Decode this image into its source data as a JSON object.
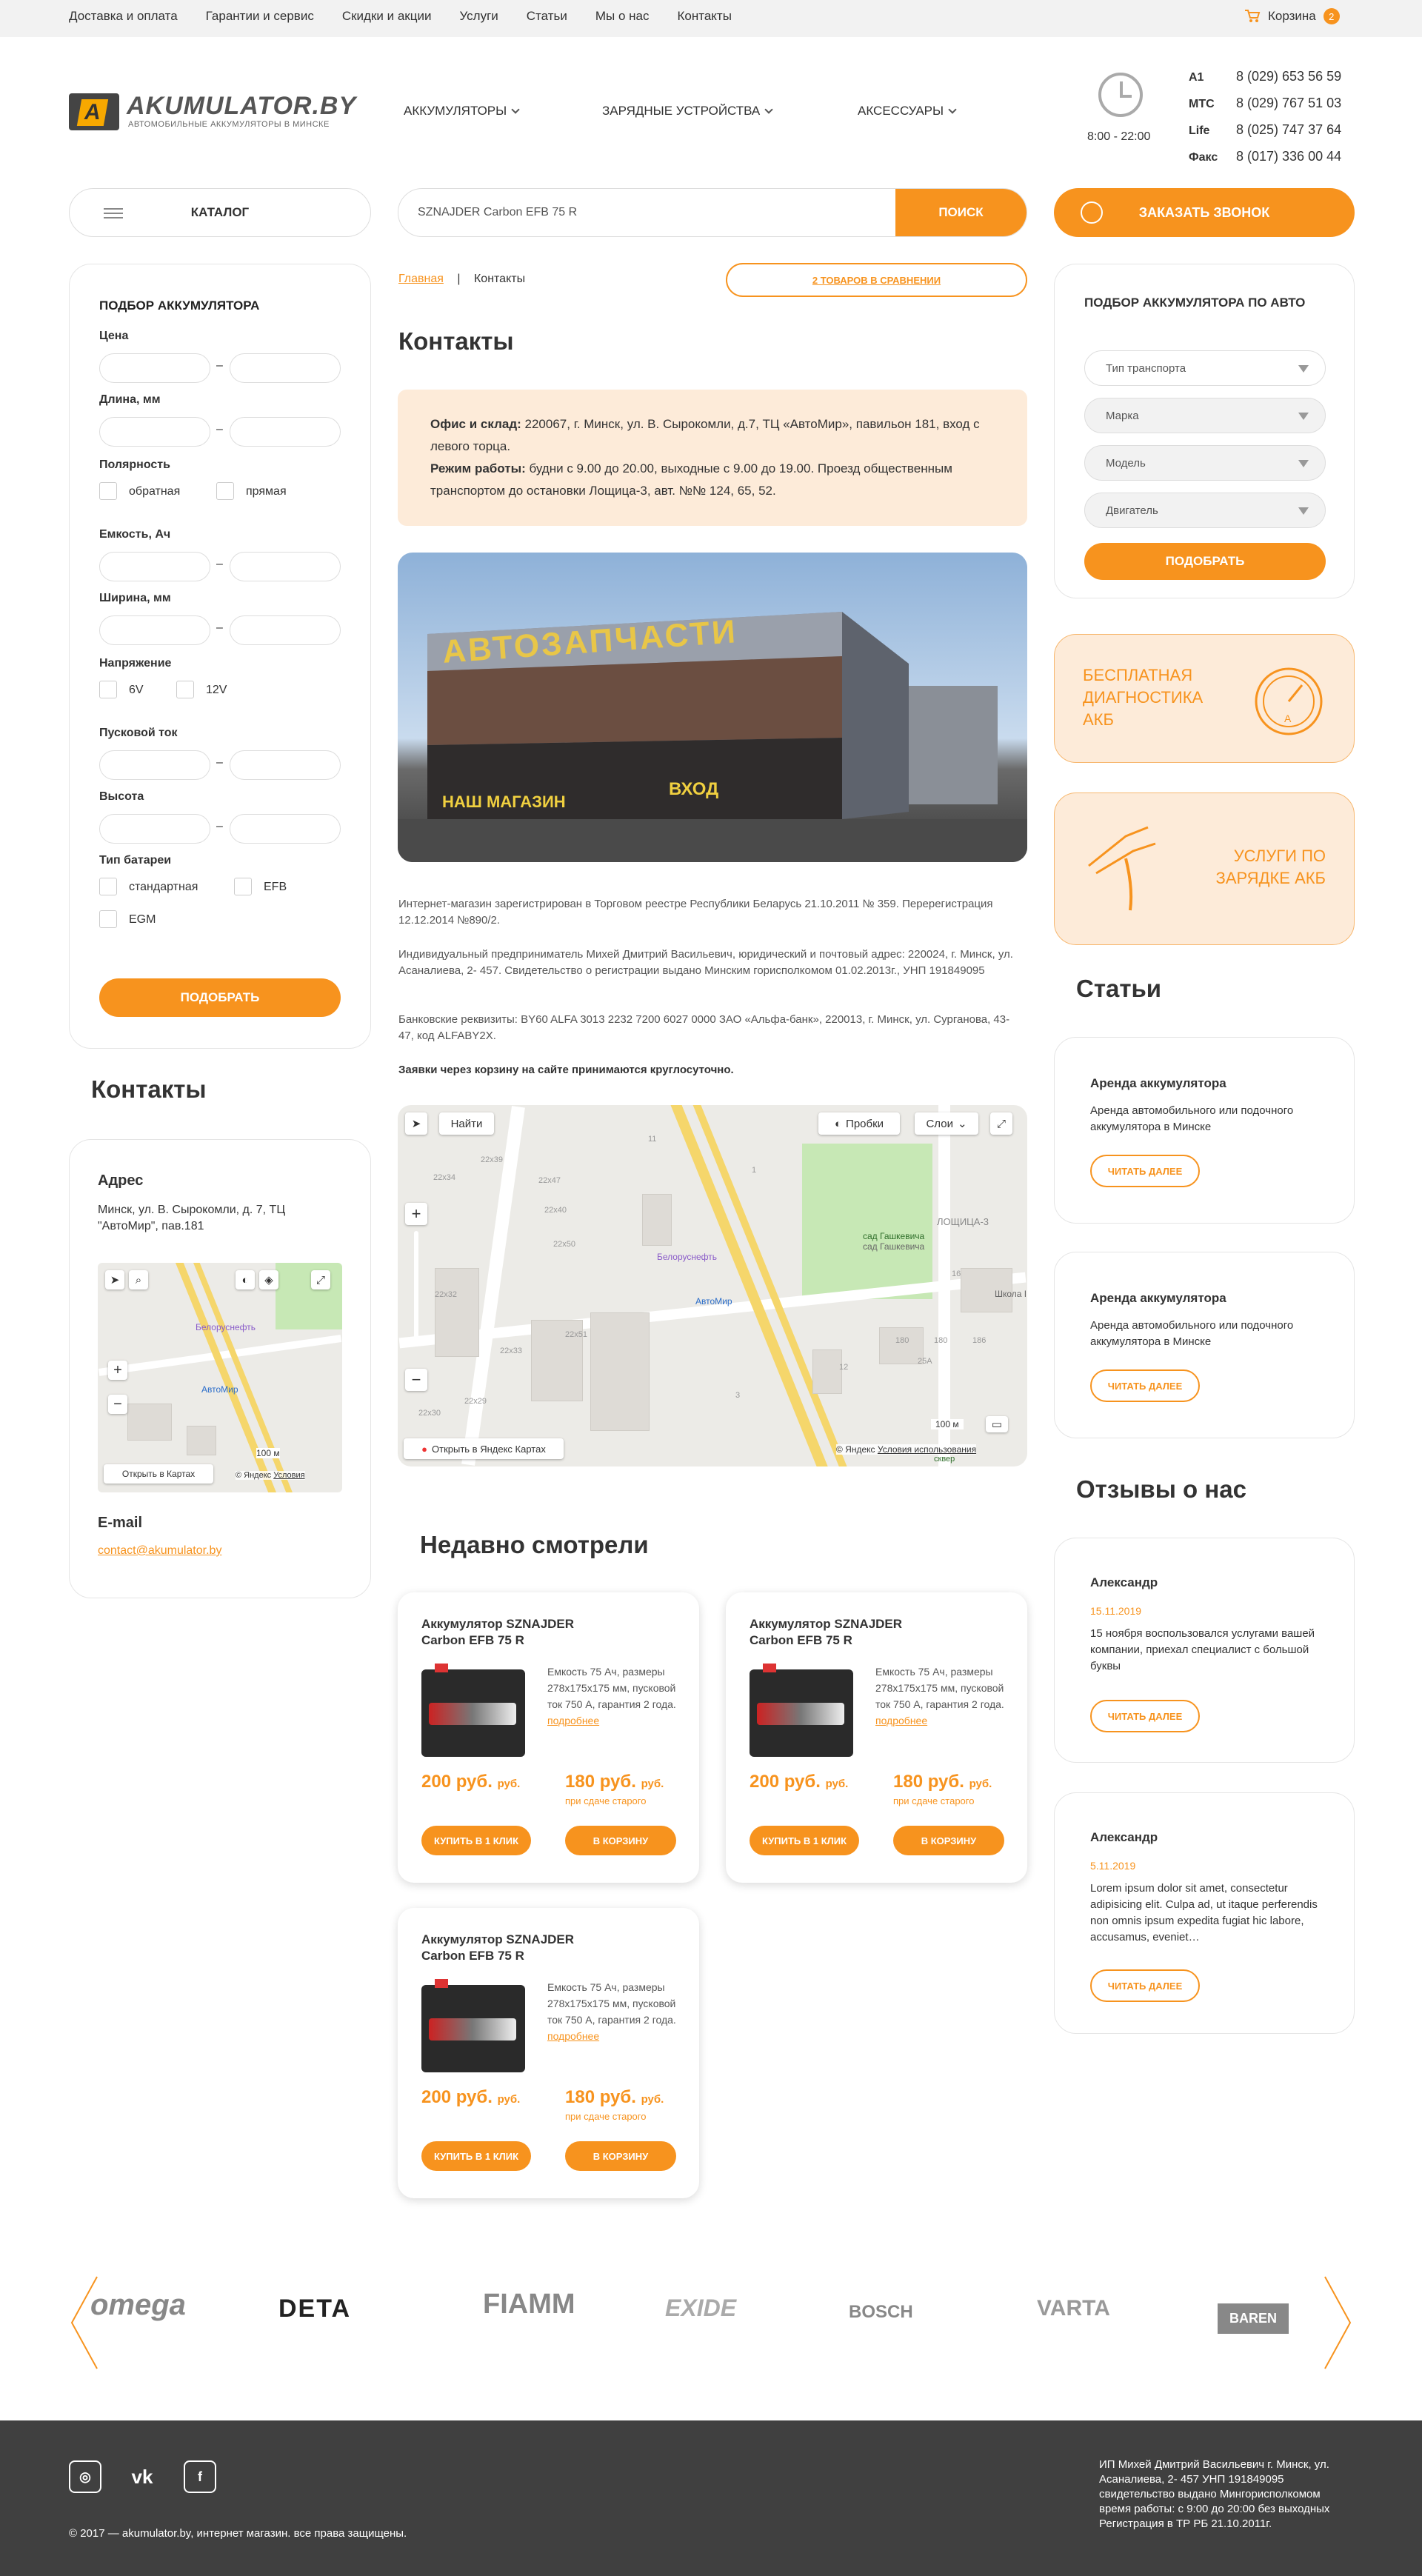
{
  "topnav": [
    "Доставка и оплата",
    "Гарантии и сервис",
    "Скидки и акции",
    "Услуги",
    "Статьи",
    "Мы о нас",
    "Контакты"
  ],
  "cart": {
    "label": "Корзина",
    "count": "2"
  },
  "logo": {
    "brand": "AKUMULATOR.BY",
    "tagline": "АВТОМОБИЛЬНЫЕ АККУМУЛЯТОРЫ В МИНСКЕ"
  },
  "mainnav": [
    "АККУМУЛЯТОРЫ",
    "ЗАРЯДНЫЕ УСТРОЙСТВА",
    "АКСЕССУАРЫ"
  ],
  "hours": "8:00 - 22:00",
  "phones": [
    {
      "op": "A1",
      "num": "8 (029) 653 56 59"
    },
    {
      "op": "МТС",
      "num": "8 (029) 767 51 03"
    },
    {
      "op": "Life",
      "num": "8 (025) 747 37 64"
    },
    {
      "op": "Факс",
      "num": "8 (017) 336 00 44"
    }
  ],
  "catalog_label": "КАТАЛОГ",
  "search": {
    "value": "SZNAJDER Carbon EFB 75 R",
    "button": "ПОИСК"
  },
  "call_label": "ЗАКАЗАТЬ ЗВОНОК",
  "filter": {
    "title": "ПОДБОР АККУМУЛЯТОРА",
    "price": "Цена",
    "length": "Длина, мм",
    "polarity": "Полярность",
    "polarity_opts": [
      "обратная",
      "прямая"
    ],
    "capacity": "Емкость, Ач",
    "width": "Ширина, мм",
    "voltage": "Напряжение",
    "voltage_opts": [
      "6V",
      "12V"
    ],
    "start": "Пусковой ток",
    "height": "Высота",
    "type": "Тип батареи",
    "type_opts": [
      "стандартная",
      "EFB",
      "EGM"
    ],
    "dash": "–",
    "button": "ПОДОБРАТЬ"
  },
  "contacts_side": {
    "title": "Контакты",
    "addr_title": "Адрес",
    "addr": "Минск, ул. В. Сырокомли, д. 7, ТЦ \"АвтоМир\", пав.181",
    "email_title": "E-mail",
    "email": "contact@akumulator.by"
  },
  "small_map": {
    "poi1": "Белоруснефть",
    "poi2": "АвтоМир",
    "scale": "100 м",
    "open": "Открыть в Картах",
    "credit": "© Яндекс",
    "terms": "Условия"
  },
  "breadcrumbs": {
    "home": "Главная",
    "sep": "|",
    "current": "Контакты"
  },
  "compare": "2 ТОВАРОВ В СРАВНЕНИИ",
  "page_title": "Контакты",
  "office": {
    "l1": "Офис и склад:",
    "t1": "220067, г. Минск, ул. В. Сырокомли, д.7, ТЦ «АвтоМир», павильон 181, вход с левого торца.",
    "l2": "Режим работы:",
    "t2": "будни с 9.00 до 20.00, выходные с 9.00 до 19.00. Проезд общественным транспортом до остановки Лощица-3, авт. №№ 124, 65, 52."
  },
  "photo": {
    "sign": "АВТОЗАПЧАСТИ",
    "store": "НАШ МАГАЗИН",
    "entrance": "ВХОД"
  },
  "texts": [
    "Интернет-магазин зарегистрирован в Торговом реестре Республики Беларусь 21.10.2011 № 359. Перерегистрация 12.12.2014 №890/2.",
    "Индивидуальный предприниматель Михей Дмитрий Васильевич, юридический и почтовый адрес: 220024, г. Минск, ул. Асаналиева, 2- 457. Свидетельство о регистрации выдано Минским горисполкомом 01.02.2013г., УНП 191849095",
    "Банковские реквизиты: BY60 ALFA 3013 2232 7200 6027 0000 ЗАО «Альфа-банк», 220013, г. Минск, ул. Сурганова, 43-47, код ALFABY2X.",
    "Заявки через корзину на сайте принимаются круглосуточно."
  ],
  "big_map": {
    "find": "Найти",
    "traffic": "Пробки",
    "layers": "Слои",
    "park": "сад Гашкевича",
    "park2": "сад Гашкевича",
    "area": "ЛОЩИЦА-3",
    "poi1": "Белоруснефть",
    "poi2": "АвтоМир",
    "school": "Школа I",
    "scale": "100 м",
    "open": "Открыть в Яндекс Картах",
    "credit": "© Яндекс",
    "terms": "Условия использования",
    "sq": "сквер",
    "labels": [
      "22х34",
      "22х39",
      "22х47",
      "22х40",
      "22х50",
      "22х51",
      "22х32",
      "22х33",
      "22х29",
      "22х30",
      "11",
      "1",
      "16",
      "180",
      "180",
      "186",
      "25А",
      "12",
      "3"
    ]
  },
  "recent": {
    "title": "Недавно смотрели",
    "products": [
      {
        "name": "Аккумулятор SZNAJDER Carbon EFB 75 R",
        "desc": "Емкость 75 Ач, размеры 278х175х175 мм, пусковой ток 750 А, гарантия 2 года.",
        "more": "подробнее",
        "price": "200 руб.",
        "cur": "руб.",
        "price2": "180 руб.",
        "cur2": "руб.",
        "note": "при сдаче старого",
        "buy": "КУПИТЬ В 1 КЛИК",
        "cart": "В КОРЗИНУ"
      },
      {
        "name": "Аккумулятор SZNAJDER Carbon EFB 75 R",
        "desc": "Емкость 75 Ач, размеры 278х175х175 мм, пусковой ток 750 А, гарантия 2 года.",
        "more": "подробнее",
        "price": "200 руб.",
        "cur": "руб.",
        "price2": "180 руб.",
        "cur2": "руб.",
        "note": "при сдаче старого",
        "buy": "КУПИТЬ В 1 КЛИК",
        "cart": "В КОРЗИНУ"
      },
      {
        "name": "Аккумулятор SZNAJDER Carbon EFB 75 R",
        "desc": "Емкость 75 Ач, размеры 278х175х175 мм, пусковой ток 750 А, гарантия 2 года.",
        "more": "подробнее",
        "price": "200 руб.",
        "cur": "руб.",
        "price2": "180 руб.",
        "cur2": "руб.",
        "note": "при сдаче старого",
        "buy": "КУПИТЬ В 1 КЛИК",
        "cart": "В КОРЗИНУ"
      }
    ]
  },
  "auto": {
    "title": "ПОДБОР АККУМУЛЯТОРА ПО АВТО",
    "selects": [
      "Тип транспорта",
      "Марка",
      "Модель",
      "Двигатель"
    ],
    "button": "ПОДОБРАТЬ"
  },
  "promo1": "БЕСПЛАТНАЯ ДИАГНОСТИКА АКБ",
  "promo2": "УСЛУГИ ПО ЗАРЯДКЕ АКБ",
  "articles": {
    "title": "Статьи",
    "items": [
      {
        "title": "Аренда аккумулятора",
        "text": "Аренда автомобильного или подочного аккумулятора в Минске",
        "btn": "ЧИТАТЬ ДАЛЕЕ"
      },
      {
        "title": "Аренда аккумулятора",
        "text": "Аренда автомобильного или подочного аккумулятора в Минске",
        "btn": "ЧИТАТЬ ДАЛЕЕ"
      }
    ]
  },
  "reviews": {
    "title": "Отзывы о нас",
    "items": [
      {
        "name": "Александр",
        "date": "15.11.2019",
        "text": "15 ноября воспользовался услугами вашей компании, приехал специалист с большой буквы",
        "btn": "ЧИТАТЬ ДАЛЕЕ"
      },
      {
        "name": "Александр",
        "date": "5.11.2019",
        "text": "Lorem ipsum dolor sit amet, consectetur adipisicing elit. Culpa ad, ut itaque perferendis non omnis ipsum expedita fugiat hic labore, accusamus, eveniet…",
        "btn": "ЧИТАТЬ ДАЛЕЕ"
      }
    ]
  },
  "brands": [
    "omega",
    "DETA",
    "FIAMM",
    "EXIDE",
    "BOSCH",
    "VARTA",
    "BAREN"
  ],
  "footer": {
    "copy": "© 2017 — akumulator.by, интернет магазин. все права защищены.",
    "info": "ИП Михей Дмитрий Васильевич г. Минск, ул. Асаналиева, 2- 457 УНП 191849095 свидетельство выдано Мингорисполкомом время работы: с 9:00 до 20:00 без выходных Регистрация в ТР РБ 21.10.2011г."
  },
  "colors": {
    "accent": "#f7931e",
    "light": "#fdebd9",
    "footer": "#404040"
  }
}
